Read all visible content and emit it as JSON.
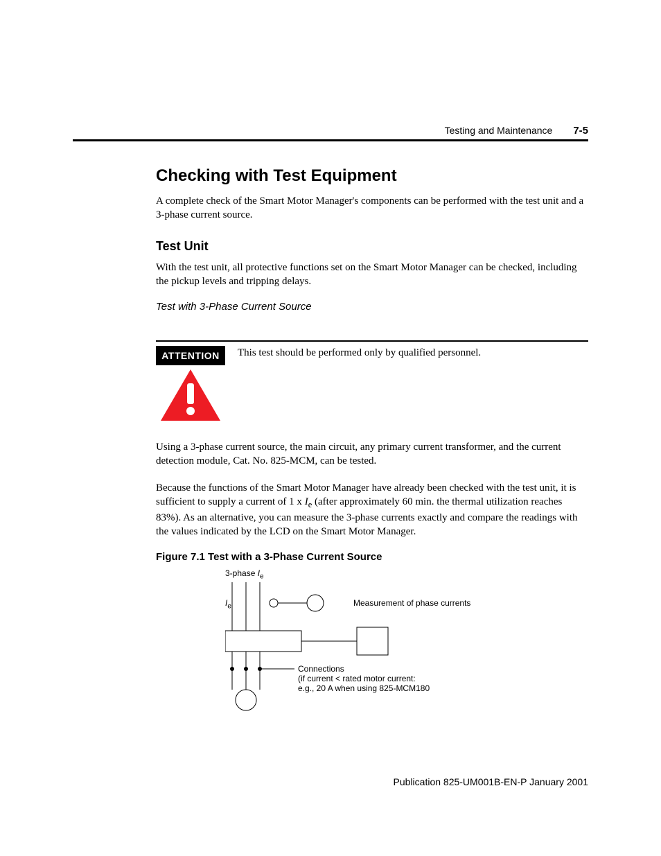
{
  "header": {
    "section": "Testing and Maintenance",
    "page": "7-5"
  },
  "h1": "Checking with Test Equipment",
  "intro": "A complete check of the Smart Motor Manager's components can be performed with the test unit and a 3-phase current source.",
  "h2": "Test Unit",
  "testunit_p": "With the test unit, all protective functions set on the Smart Motor Manager can be checked, including the pickup levels and tripping delays.",
  "subhead": "Test with 3-Phase Current Source",
  "attention_label": "ATTENTION",
  "attention_text": "This test should be performed only by qualified personnel.",
  "para2": "Using a 3-phase current source, the main circuit, any primary current transformer, and the current detection module, Cat. No. 825-MCM, can be tested.",
  "para3a": "Because the functions of the Smart Motor Manager have already been checked with the test unit, it is sufficient to supply a current of 1 x ",
  "para3_var": "I",
  "para3_sub": "e",
  "para3b": " (after approximately 60 min. the thermal utilization reaches 83%). As an alternative, you can measure the 3-phase currents exactly and compare the readings with the values indicated by the LCD on the Smart Motor Manager.",
  "fig_title": "Figure 7.1 Test with a 3-Phase Current Source",
  "diag": {
    "top": "3-phase ",
    "top_var": "I",
    "top_sub": "e",
    "meas_var": "I",
    "meas_sub": "e",
    "meas": "Measurement of phase currents",
    "conn1": "Connections",
    "conn2": "(if current < rated motor current:",
    "conn3": "e.g., 20 A when using 825-MCM180"
  },
  "pub": "Publication 825-UM001B-EN-P  January 2001"
}
